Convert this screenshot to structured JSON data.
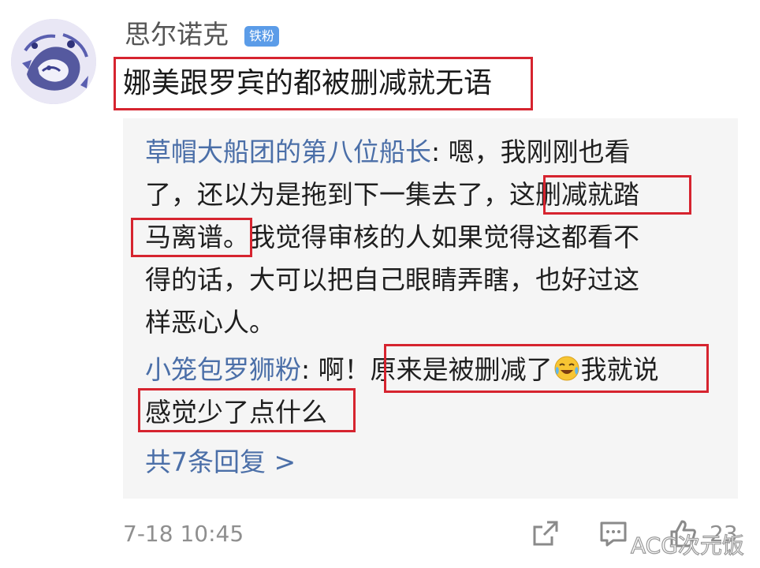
{
  "post": {
    "username": "思尔诺克",
    "badge": "铁粉",
    "text": "娜美跟罗宾的都被删减就无语"
  },
  "replies": {
    "r1_user": "草帽大船团的第八位船长",
    "r1_line1_rest": ": 嗯，我刚刚也看",
    "r1_line2": "了，还以为是拖到下一集去了，这删减就踏",
    "r1_line3": "马离谱。我觉得审核的人如果觉得这都看不",
    "r1_line4": "得的话，大可以把自己眼睛弄瞎，也好过这",
    "r1_line5": "样恶心人。",
    "r2_user": "小笼包罗狮粉",
    "r2_line1_a": ": 啊！原来是被删减了",
    "r2_line1_b": "我就说",
    "r2_line2": "感觉少了点什么",
    "more": "共7条回复 >"
  },
  "footer": {
    "timestamp": "7-18 10:45",
    "like_count": "23",
    "watermark": "ACG次元饭"
  },
  "icons": {
    "share": "share-icon",
    "comment": "comment-icon",
    "like": "thumbs-up-icon",
    "emoji": "laughing-crying-emoji"
  },
  "colors": {
    "highlight": "#d6242f",
    "username_link": "#4b6fa8",
    "badge": "#5b9ce8",
    "reply_panel": "#f5f5f5"
  }
}
